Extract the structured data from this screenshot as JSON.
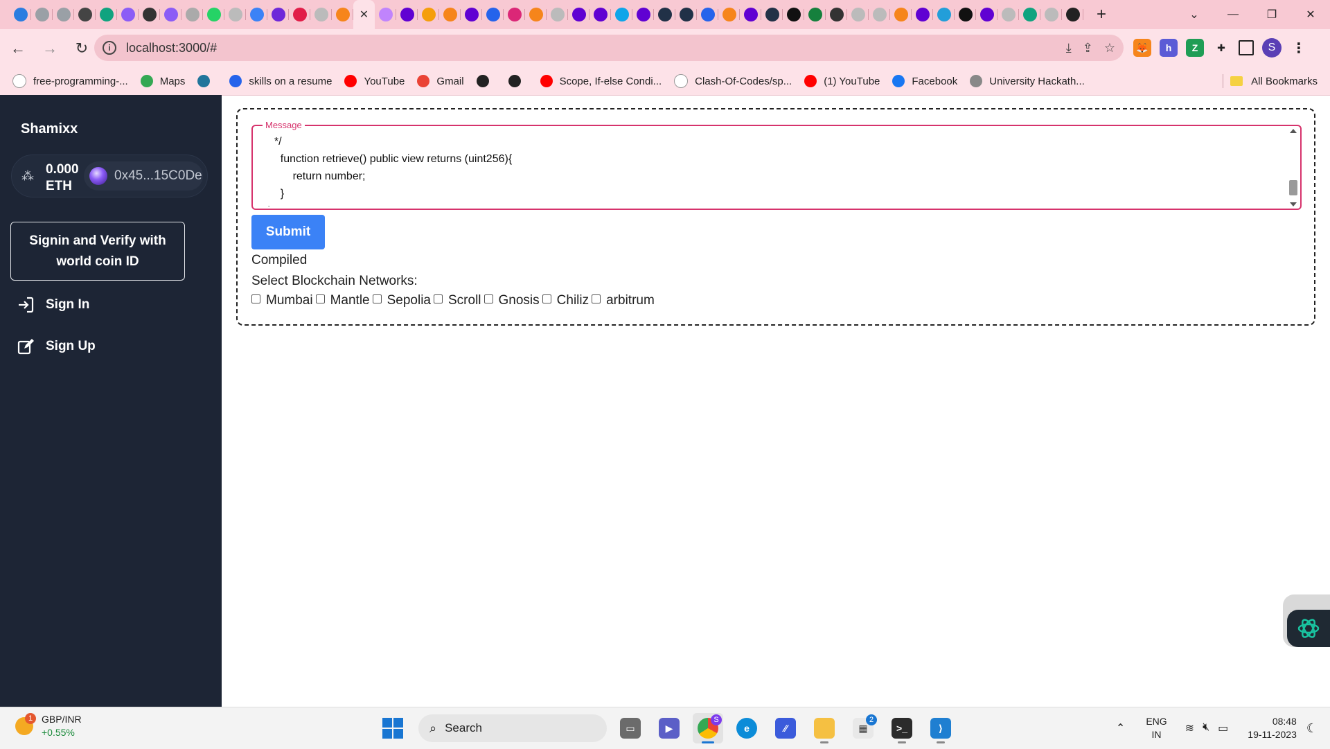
{
  "browser": {
    "url": "localhost:3000/#",
    "tab_icons": [
      {
        "name": "edge-tab-icon",
        "color": "#2b7de0"
      },
      {
        "name": "openai-tab-icon",
        "color": "#9aa0a6"
      },
      {
        "name": "openai-tab-icon",
        "color": "#9aa0a6"
      },
      {
        "name": "chatgpt-tab-icon",
        "color": "#444444"
      },
      {
        "name": "chatgpt-tab-icon",
        "color": "#10a37f"
      },
      {
        "name": "purple-tab-icon",
        "color": "#8b5cf6"
      },
      {
        "name": "square-tab-icon",
        "color": "#333333"
      },
      {
        "name": "purple-tab-icon",
        "color": "#8b5cf6"
      },
      {
        "name": "google-tab-icon",
        "color": "#aaaaaa"
      },
      {
        "name": "whatsapp-tab-icon",
        "color": "#25d366"
      },
      {
        "name": "grey-tab-icon",
        "color": "#bbbbbb"
      },
      {
        "name": "wave-tab-icon",
        "color": "#3b82f6"
      },
      {
        "name": "code-tab-icon",
        "color": "#6d28d9"
      },
      {
        "name": "red-tab-icon",
        "color": "#e11d48"
      },
      {
        "name": "grey-tab-icon",
        "color": "#bbbbbb"
      },
      {
        "name": "metamask-tab-icon",
        "color": "#f6851b"
      },
      {
        "name": "active-tab-close-icon",
        "color": "#333333"
      },
      {
        "name": "openai-tab-icon",
        "color": "#c084fc"
      },
      {
        "name": "yahoo-tab-icon",
        "color": "#6001d2"
      },
      {
        "name": "hand-tab-icon",
        "color": "#f59e0b"
      },
      {
        "name": "metamask-tab-icon",
        "color": "#f6851b"
      },
      {
        "name": "yahoo-tab-icon",
        "color": "#6001d2"
      },
      {
        "name": "blue-tab-icon",
        "color": "#2563eb"
      },
      {
        "name": "pink-tab-icon",
        "color": "#db2777"
      },
      {
        "name": "metamask-tab-icon",
        "color": "#f6851b"
      },
      {
        "name": "grey-tab-icon",
        "color": "#bbbbbb"
      },
      {
        "name": "yahoo-tab-icon",
        "color": "#6001d2"
      },
      {
        "name": "yahoo-tab-icon",
        "color": "#6001d2"
      },
      {
        "name": "search-tab-icon",
        "color": "#0ea5e9"
      },
      {
        "name": "yahoo-tab-icon",
        "color": "#6001d2"
      },
      {
        "name": "arbitrum-tab-icon",
        "color": "#213147"
      },
      {
        "name": "arbitrum-tab-icon",
        "color": "#213147"
      },
      {
        "name": "blue-tab-icon",
        "color": "#2563eb"
      },
      {
        "name": "metamask-tab-icon",
        "color": "#f6851b"
      },
      {
        "name": "yahoo-tab-icon",
        "color": "#6001d2"
      },
      {
        "name": "arbitrum-tab-icon",
        "color": "#213147"
      },
      {
        "name": "b-tab-icon",
        "color": "#111111"
      },
      {
        "name": "globe-tab-icon",
        "color": "#15803d"
      },
      {
        "name": "notes-tab-icon",
        "color": "#333333"
      },
      {
        "name": "github-tab-icon",
        "color": "#bbbbbb"
      },
      {
        "name": "grey-tab-icon",
        "color": "#bbbbbb"
      },
      {
        "name": "metamask-tab-icon",
        "color": "#f6851b"
      },
      {
        "name": "yahoo-tab-icon",
        "color": "#6001d2"
      },
      {
        "name": "telegram-tab-icon",
        "color": "#229ed9"
      },
      {
        "name": "x-tab-icon",
        "color": "#111111"
      },
      {
        "name": "yahoo-tab-icon",
        "color": "#6001d2"
      },
      {
        "name": "grey-tab-icon",
        "color": "#bbbbbb"
      },
      {
        "name": "chatgpt-tab-icon",
        "color": "#10a37f"
      },
      {
        "name": "grey-tab-icon",
        "color": "#bbbbbb"
      },
      {
        "name": "react-tab-icon",
        "color": "#222222"
      }
    ],
    "bookmarks": [
      {
        "label": "free-programming-...",
        "icon": "github-icon",
        "color": "#ffffff"
      },
      {
        "label": "Maps",
        "icon": "maps-icon",
        "color": "#34a853"
      },
      {
        "label": "",
        "icon": "wordpress-icon",
        "color": "#21759b"
      },
      {
        "label": "skills on a resume",
        "icon": "cursor-icon",
        "color": "#2563eb"
      },
      {
        "label": "YouTube",
        "icon": "youtube-icon",
        "color": "#ff0000"
      },
      {
        "label": "Gmail",
        "icon": "gmail-icon",
        "color": "#ea4335"
      },
      {
        "label": "",
        "icon": "globe-icon",
        "color": "#222222"
      },
      {
        "label": "",
        "icon": "globe-icon",
        "color": "#222222"
      },
      {
        "label": "Scope, If-else Condi...",
        "icon": "youtube-icon",
        "color": "#ff0000"
      },
      {
        "label": "Clash-Of-Codes/sp...",
        "icon": "github-icon",
        "color": "#ffffff"
      },
      {
        "label": "(1) YouTube",
        "icon": "youtube-icon",
        "color": "#ff0000"
      },
      {
        "label": "Facebook",
        "icon": "facebook-icon",
        "color": "#1877f2"
      },
      {
        "label": "University Hackath...",
        "icon": "e-icon",
        "color": "#888888"
      }
    ],
    "all_bookmarks": "All Bookmarks"
  },
  "sidebar": {
    "brand": "Shamixx",
    "balance": "0.000",
    "currency": "ETH",
    "address": "0x45...15C0De",
    "worldcoin_button": "Signin and Verify with world coin ID",
    "sign_in": "Sign In",
    "sign_up": "Sign Up"
  },
  "form": {
    "legend": "Message",
    "code": "  */\n    function retrieve() public view returns (uint256){\n        return number;\n    }\n}",
    "submit": "Submit",
    "status": "Compiled",
    "select_label": "Select Blockchain Networks:",
    "networks": [
      "Mumbai",
      "Mantle",
      "Sepolia",
      "Scroll",
      "Gnosis",
      "Chiliz",
      "arbitrum"
    ]
  },
  "taskbar": {
    "ticker": "GBP/INR",
    "ticker_change": "+0.55%",
    "widget_badge": "1",
    "search_label": "Search",
    "chrome_badge": "S",
    "store_badge": "2",
    "lang_top": "ENG",
    "lang_bottom": "IN",
    "time": "08:48",
    "date": "19-11-2023"
  }
}
